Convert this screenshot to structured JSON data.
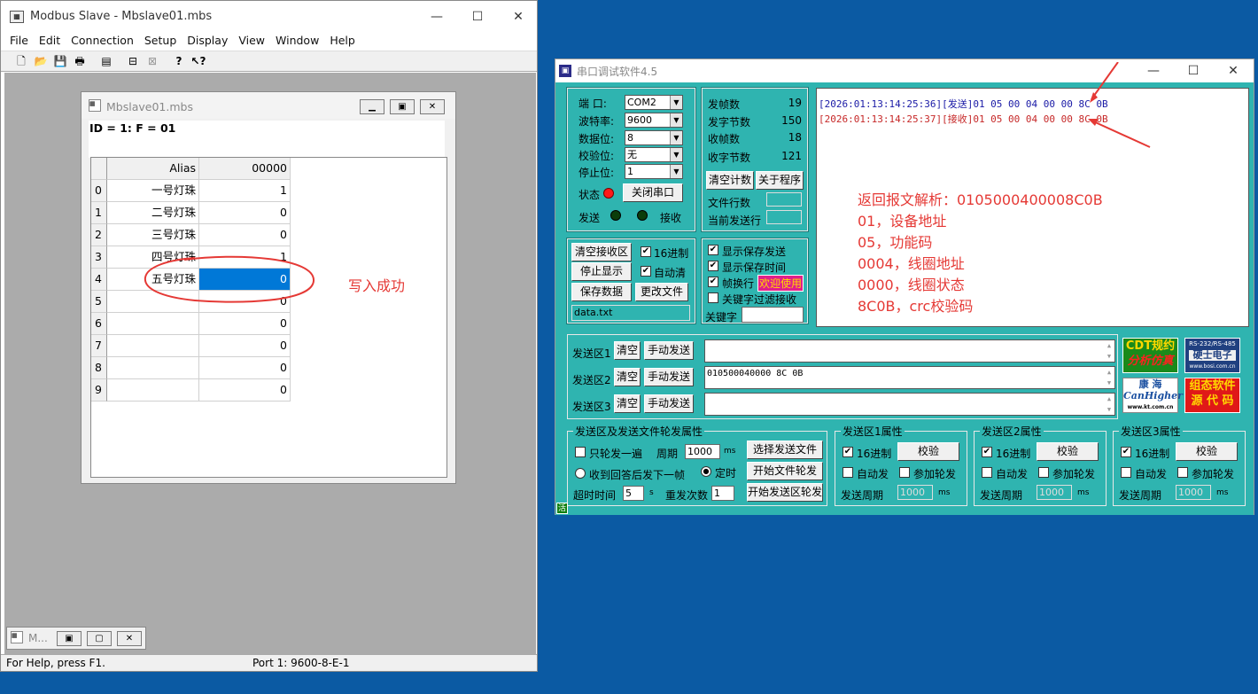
{
  "modbus": {
    "title": "Modbus Slave - Mbslave01.mbs",
    "menus": [
      "File",
      "Edit",
      "Connection",
      "Setup",
      "Display",
      "View",
      "Window",
      "Help"
    ],
    "child_title": "Mbslave01.mbs",
    "id_line": "ID = 1: F = 01",
    "grid": {
      "alias_header": "Alias",
      "value_header": "00000",
      "rows": [
        {
          "idx": "0",
          "alias": "一号灯珠",
          "value": "1"
        },
        {
          "idx": "1",
          "alias": "二号灯珠",
          "value": "0"
        },
        {
          "idx": "2",
          "alias": "三号灯珠",
          "value": "0"
        },
        {
          "idx": "3",
          "alias": "四号灯珠",
          "value": "1"
        },
        {
          "idx": "4",
          "alias": "五号灯珠",
          "value": "0"
        },
        {
          "idx": "5",
          "alias": "",
          "value": "0"
        },
        {
          "idx": "6",
          "alias": "",
          "value": "0"
        },
        {
          "idx": "7",
          "alias": "",
          "value": "0"
        },
        {
          "idx": "8",
          "alias": "",
          "value": "0"
        },
        {
          "idx": "9",
          "alias": "",
          "value": "0"
        }
      ]
    },
    "minimized_title": "M...",
    "status_left": "For Help, press F1.",
    "status_right": "Port 1: 9600-8-E-1",
    "annotation": "写入成功"
  },
  "serial": {
    "title": "串口调试软件4.5",
    "port_label": "端  口:",
    "port_value": "COM2",
    "baud_label": "波特率:",
    "baud_value": "9600",
    "databits_label": "数据位:",
    "databits_value": "8",
    "parity_label": "校验位:",
    "parity_value": "无",
    "stopbits_label": "停止位:",
    "stopbits_value": "1",
    "state_label": "状态",
    "close_port_button": "关闭串口",
    "send_led_label": "发送",
    "recv_led_label": "接收",
    "stats": [
      {
        "label": "发帧数",
        "value": "19"
      },
      {
        "label": "发字节数",
        "value": "150"
      },
      {
        "label": "收帧数",
        "value": "18"
      },
      {
        "label": "收字节数",
        "value": "121"
      }
    ],
    "clear_count_button": "清空计数",
    "about_button": "关于程序",
    "file_lines_label": "文件行数",
    "current_line_label": "当前发送行",
    "clear_recv_button": "清空接收区",
    "hex_label": "16进制",
    "stop_display_button": "停止显示",
    "auto_clear_label": "自动清",
    "save_data_button": "保存数据",
    "change_file_button": "更改文件",
    "file_name": "data.txt",
    "show_save_send": "显示保存发送",
    "show_save_time": "显示保存时间",
    "frame_wrap": "帧换行",
    "welcome": "欢迎使用",
    "keyword_filter": "关键字过滤接收",
    "keyword_label": "关键字",
    "recv_lines": [
      {
        "text": "[2026:01:13:14:25:36][发送]01 05 00 04 00 00 8C 0B",
        "color": "#1a1aa6"
      },
      {
        "text": "[2026:01:13:14:25:37][接收]01 05 00 04 00 00 8C 0B",
        "color": "#c62828"
      }
    ],
    "analysis": [
      "返回报文解析：0105000400008C0B",
      "01，设备地址",
      "05，功能码",
      "0004，线圈地址",
      "0000，线圈状态",
      "8C0B，crc校验码"
    ],
    "send_rows": [
      {
        "label": "发送区1",
        "clear": "清空",
        "manual": "手动发送",
        "value": ""
      },
      {
        "label": "发送区2",
        "clear": "清空",
        "manual": "手动发送",
        "value": "010500040000 8C 0B"
      },
      {
        "label": "发送区3",
        "clear": "清空",
        "manual": "手动发送",
        "value": ""
      }
    ],
    "ads": {
      "cdt1": "CDT规约",
      "cdt2": "分析仿真",
      "bosi_top": "RS-232/RS-485",
      "bosi_mid": "硬士电子",
      "bosi_url": "www.bosi.com.cn",
      "kh1": "康 海",
      "kh2": "CanHigher",
      "kh3": "www.kt.com.cn",
      "src1": "组态软件",
      "src2": "源 代 码"
    },
    "poll": {
      "title": "发送区及发送文件轮发属性",
      "once": "只轮发一遍",
      "period_label": "周期",
      "period_value": "1000",
      "ms": "ms",
      "select_file": "选择发送文件",
      "after_reply": "收到回答后发下一帧",
      "timed": "定时",
      "start_file": "开始文件轮发",
      "timeout_label": "超时时间",
      "timeout_value": "5",
      "s": "s",
      "retry_label": "重发次数",
      "retry_value": "1",
      "start_area": "开始发送区轮发"
    },
    "area_props": [
      {
        "title": "发送区1属性",
        "hex": "16进制",
        "check": "校验",
        "auto": "自动发",
        "join": "参加轮发",
        "period_label": "发送周期",
        "period": "1000",
        "ms": "ms"
      },
      {
        "title": "发送区2属性",
        "hex": "16进制",
        "check": "校验",
        "auto": "自动发",
        "join": "参加轮发",
        "period_label": "发送周期",
        "period": "1000",
        "ms": "ms"
      },
      {
        "title": "发送区3属性",
        "hex": "16进制",
        "check": "校验",
        "auto": "自动发",
        "join": "参加轮发",
        "period_label": "发送周期",
        "period": "1000",
        "ms": "ms"
      }
    ],
    "corner_icon": "活"
  }
}
